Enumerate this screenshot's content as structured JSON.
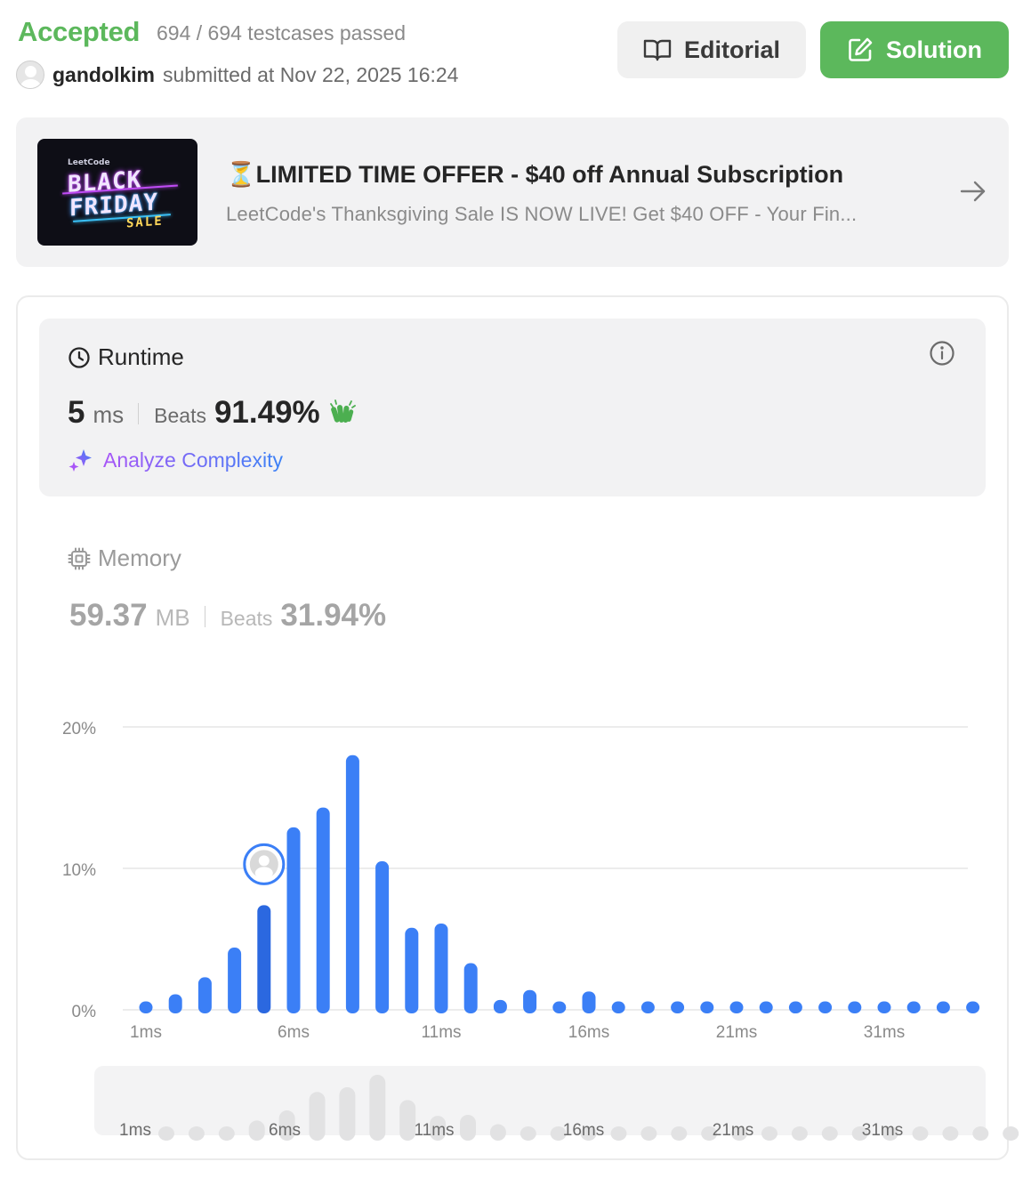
{
  "header": {
    "status": "Accepted",
    "testcases": "694 / 694 testcases passed",
    "username": "gandolkim",
    "submitted": "submitted at Nov 22, 2025 16:24",
    "editorial_label": "Editorial",
    "solution_label": "Solution"
  },
  "promo": {
    "image_brand": "LeetCode",
    "image_line1": "BLACK",
    "image_line2": "FRIDAY",
    "image_line3": "SALE",
    "title": "⏳LIMITED TIME OFFER - $40 off Annual Subscription",
    "subtitle": "LeetCode's Thanksgiving Sale IS NOW LIVE! Get $40 OFF - Your Fin..."
  },
  "runtime": {
    "label": "Runtime",
    "value": "5",
    "unit": "ms",
    "beats_label": "Beats",
    "beats_pct": "91.49%",
    "analyze_label": "Analyze Complexity"
  },
  "memory": {
    "label": "Memory",
    "value": "59.37",
    "unit": "MB",
    "beats_label": "Beats",
    "beats_pct": "31.94%"
  },
  "colors": {
    "accepted": "#5cb85c",
    "bar": "#3b7ff6",
    "bar_current": "#2b68e0"
  },
  "chart_data": {
    "type": "bar",
    "y_tick_labels": [
      "20%",
      "10%",
      "0%"
    ],
    "ylim": [
      0,
      20
    ],
    "x_tick_labels": [
      "1ms",
      "6ms",
      "11ms",
      "16ms",
      "21ms",
      "31ms"
    ],
    "categories": [
      "1ms",
      "2ms",
      "3ms",
      "4ms",
      "5ms",
      "6ms",
      "7ms",
      "8ms",
      "9ms",
      "10ms",
      "11ms",
      "12ms",
      "13ms",
      "14ms",
      "15ms",
      "16ms",
      "17ms",
      "18ms",
      "19ms",
      "20ms",
      "21ms",
      "22ms",
      "23ms",
      "24ms",
      "25ms",
      "26ms",
      "27ms",
      "28ms",
      "29ms"
    ],
    "values": [
      0.6,
      1.1,
      2.3,
      4.4,
      7.4,
      12.9,
      14.3,
      18.0,
      10.5,
      5.8,
      6.1,
      3.3,
      0.7,
      1.4,
      0.6,
      1.3,
      0.6,
      0.6,
      0.6,
      0.6,
      0.6,
      0.6,
      0.6,
      0.6,
      0.6,
      0.6,
      0.6,
      0.6,
      0.6
    ],
    "current_index": 4,
    "navigator_tick_labels": [
      "1ms",
      "6ms",
      "11ms",
      "16ms",
      "21ms",
      "31ms"
    ]
  }
}
